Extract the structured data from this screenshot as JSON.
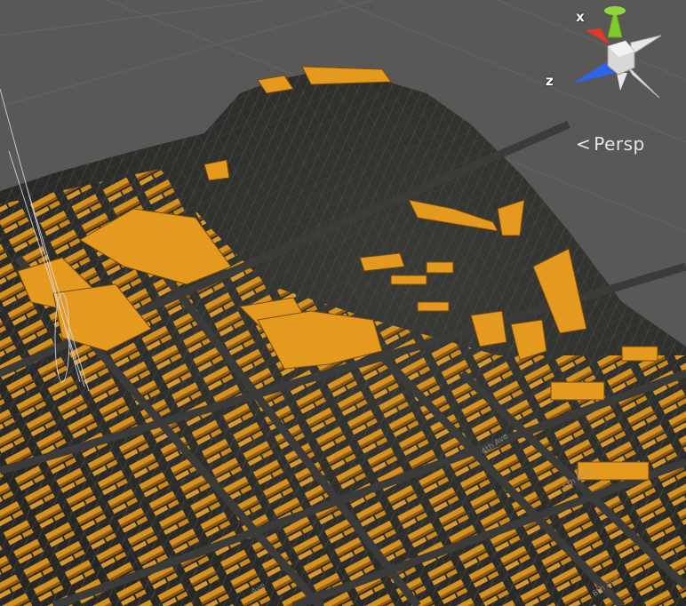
{
  "view": {
    "mode_label": "Persp",
    "back_chevron": "<"
  },
  "gizmo": {
    "x_label": "x",
    "z_label": "z",
    "colors": {
      "x": "#e23a2a",
      "y": "#7ecb2a",
      "z": "#2f63e8",
      "neutral": "#e8e8e8"
    }
  },
  "scene": {
    "colors": {
      "background": "#5a5856",
      "terrain": "#2f2f2d",
      "mesh": "#4a4a47",
      "building": "#e39a1e",
      "building_shadow": "#b06e10"
    }
  },
  "street_labels": [
    "Ave",
    "4th Ave",
    "5th Ave",
    "6th Ave"
  ]
}
